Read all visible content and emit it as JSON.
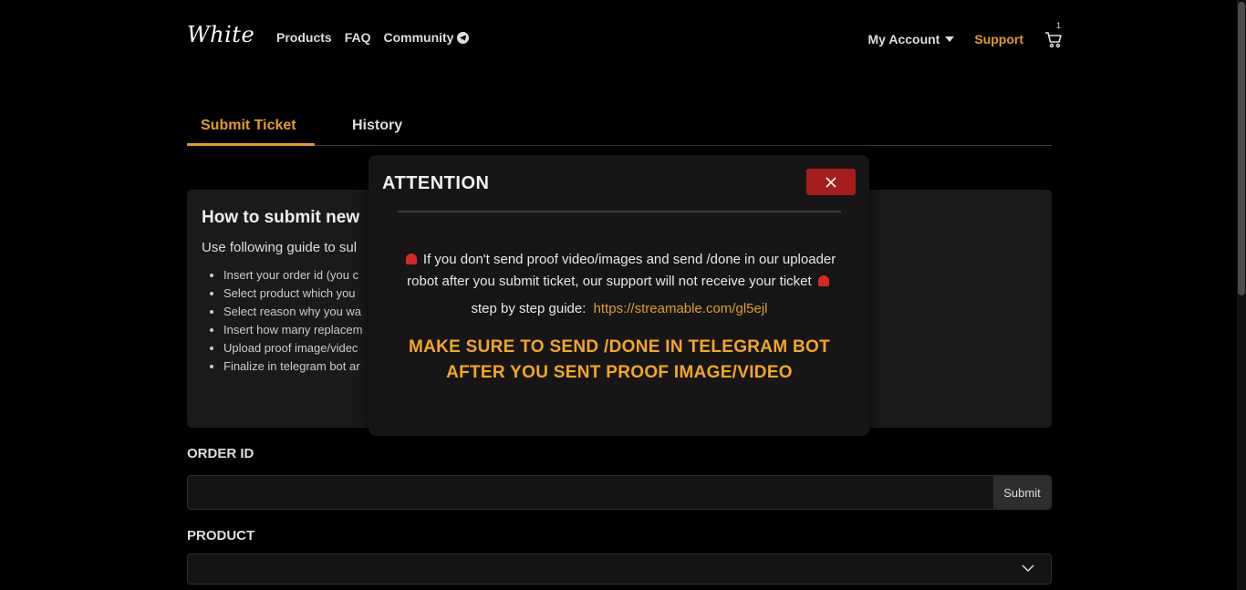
{
  "nav": {
    "logo": "White",
    "links": [
      "Products",
      "FAQ",
      "Community"
    ],
    "account_label": "My Account",
    "support_label": "Support",
    "cart_count": "1"
  },
  "tabs": [
    {
      "label": "Submit Ticket",
      "active": true
    },
    {
      "label": "History",
      "active": false
    }
  ],
  "guide": {
    "title": "How to submit new",
    "subtitle": "Use following guide to sul",
    "steps": [
      "Insert your order id (you c",
      "Select product which you",
      "Select reason why you wa",
      "Insert how many replacem",
      "Upload proof image/videc",
      "Finalize in telegram bot ar"
    ]
  },
  "form": {
    "order_id_label": "ORDER ID",
    "order_id_value": "",
    "submit_label": "Submit",
    "product_label": "PRODUCT",
    "product_value": ""
  },
  "modal": {
    "title": "ATTENTION",
    "message": "If you don't send proof video/images and send /done in our uploader robot after you submit ticket, our support will not receive your ticket",
    "guide_prefix": "step by step guide:",
    "guide_link": "https://streamable.com/gl5ejl",
    "warning": "MAKE SURE TO SEND /DONE IN TELEGRAM BOT AFTER YOU SENT PROOF IMAGE/VIDEO"
  },
  "colors": {
    "accent": "#e39b2f",
    "warning": "#f5a623",
    "close_button": "#a61d1d",
    "background": "#000000"
  },
  "icons": [
    "telegram-icon",
    "caret-down-icon",
    "cart-icon",
    "close-icon",
    "alarm-icon",
    "chevron-down-icon"
  ]
}
